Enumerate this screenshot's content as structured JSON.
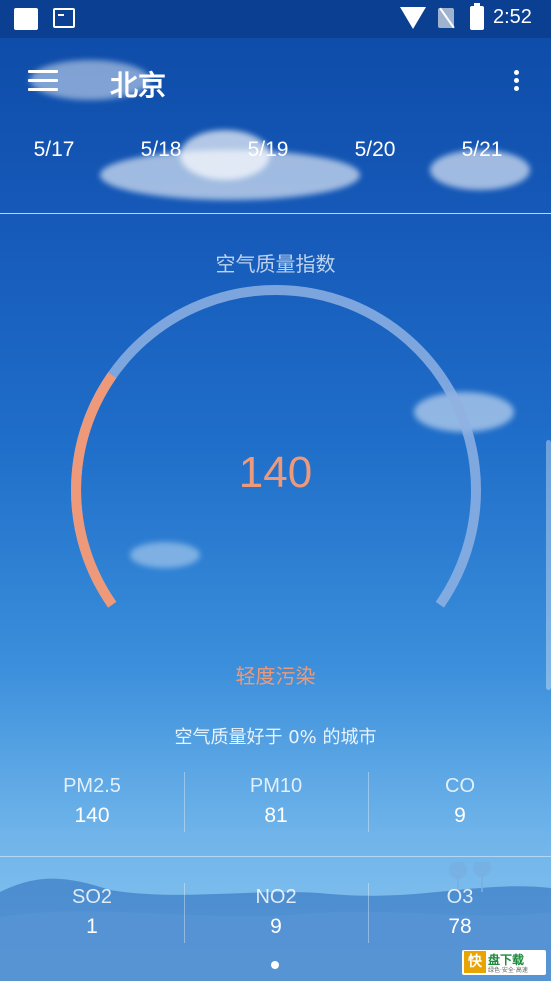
{
  "status_bar": {
    "time": "2:52"
  },
  "app_bar": {
    "city": "北京"
  },
  "dates": [
    "5/17",
    "5/18",
    "5/19",
    "5/20",
    "5/21"
  ],
  "aqi": {
    "label": "空气质量指数",
    "value": "140",
    "level": "轻度污染",
    "gauge_fraction": 0.28,
    "accent_color": "#ee9a7a",
    "track_color": "#8fb2e3",
    "rank_text": "空气质量好于 0% 的城市"
  },
  "pollutants": [
    {
      "name": "PM2.5",
      "value": "140"
    },
    {
      "name": "PM10",
      "value": "81"
    },
    {
      "name": "CO",
      "value": "9"
    },
    {
      "name": "SO2",
      "value": "1"
    },
    {
      "name": "NO2",
      "value": "9"
    },
    {
      "name": "O3",
      "value": "78"
    }
  ],
  "watermark": {
    "logo": "快",
    "title": "盘下载",
    "slogan": "绿色·安全·高速"
  }
}
